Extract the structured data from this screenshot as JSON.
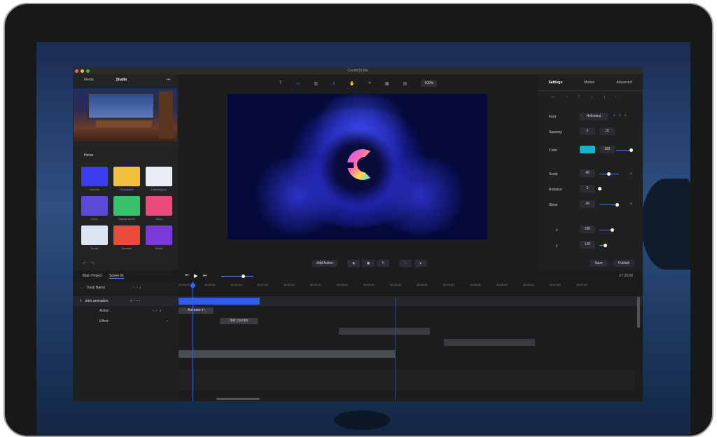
{
  "window": {
    "title": "CreateStudio"
  },
  "left_panel": {
    "tabs": [
      "Media",
      "Studio"
    ],
    "more": "•••",
    "section": "Home",
    "tiles": [
      {
        "label": "Scenes",
        "color": "#3a3df0"
      },
      {
        "label": "Characters",
        "color": "#f2c23a"
      },
      {
        "label": "Instashapes",
        "color": "#e9eef4"
      },
      {
        "label": "Icons",
        "color": "#5a4ad6"
      },
      {
        "label": "Backgrounds",
        "color": "#37c36a"
      },
      {
        "label": "Video",
        "color": "#e94a7a"
      },
      {
        "label": "Social",
        "color": "#dbe6f2"
      },
      {
        "label": "Devices",
        "color": "#e94a3a"
      },
      {
        "label": "Emoji",
        "color": "#7a3ad6"
      }
    ]
  },
  "canvas_toolbar": {
    "zoom": "100%"
  },
  "right_panel": {
    "tabs": [
      "Settings",
      "Motion",
      "Advanced"
    ],
    "font_label": "Font",
    "font_value": "Helvetica",
    "spacing_label": "Spacing",
    "spacing_a": "0",
    "spacing_b": "10",
    "color_label": "Color",
    "color_value": "#16b3c9",
    "opacity": "100",
    "scale_label": "Scale",
    "scale_value": "40",
    "rotation_label": "Rotation",
    "rotation_value": "0",
    "skew_label": "Skew",
    "skew_value": "20",
    "x_label": "x",
    "x_value": "200",
    "y_label": "y",
    "y_value": "120",
    "save": "Save",
    "publish": "Publish"
  },
  "controls": {
    "add_action": "Add Action"
  },
  "timeline": {
    "breadcrumb": [
      "Main Project",
      "Scene 01"
    ],
    "duration": "07:30:00",
    "track_name_header": "Track Name",
    "ruler": [
      "00:00:00",
      "00:00:30",
      "00:01:00",
      "00:01:30",
      "00:02:00",
      "00:02:30",
      "00:03:00",
      "00:03:30",
      "00:04:00",
      "00:04:30",
      "00:05:00",
      "00:05:30",
      "00:06:00",
      "00:06:30",
      "00:07:00",
      "00:07:30"
    ],
    "tracks": [
      {
        "name": "Intro animation"
      },
      {
        "name": "Action",
        "clip": "Animate In"
      },
      {
        "name": "Effect",
        "clip": "Text counter"
      }
    ]
  }
}
